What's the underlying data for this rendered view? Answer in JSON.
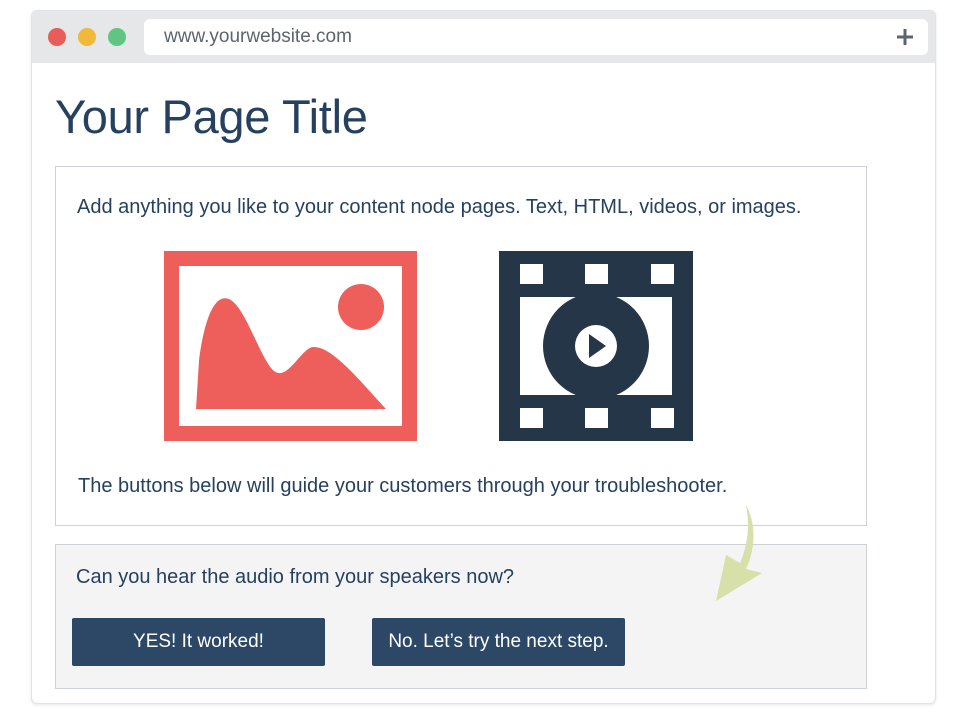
{
  "browser": {
    "url": "www.yourwebsite.com",
    "new_tab_icon": "plus-icon",
    "traffic_lights": [
      "close",
      "minimize",
      "zoom"
    ]
  },
  "page": {
    "title": "Your Page Title"
  },
  "content": {
    "intro": "Add anything you like to your content node pages. Text, HTML, videos, or images.",
    "media_icons": [
      "image-icon",
      "video-icon"
    ],
    "outro": "The buttons below will guide your customers through your troubleshooter."
  },
  "troubleshooter": {
    "question": "Can you hear the audio from your speakers now?",
    "yes_label": "YES! It worked!",
    "no_label": "No. Let’s try the next step.",
    "arrow_icon": "curved-arrow-icon"
  },
  "colors": {
    "heading": "#25415f",
    "button": "#2c4866",
    "image_icon": "#ee5e5b",
    "video_icon": "#253649",
    "arrow": "#d6e0a8",
    "traffic_close": "#e85c5a",
    "traffic_minimize": "#f0b93b",
    "traffic_zoom": "#5ec682"
  }
}
